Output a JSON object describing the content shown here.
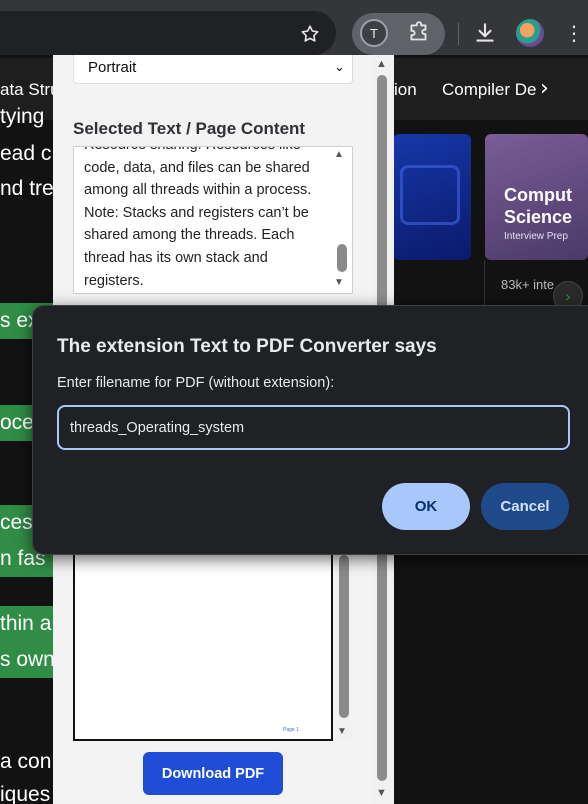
{
  "browser": {
    "star_icon": "star-icon",
    "extension_badge": "T",
    "puzzle_icon": "puzzle-icon",
    "download_icon": "download-icon",
    "menu_icon": "more-vert-icon"
  },
  "site": {
    "nav": [
      "ata Stru",
      "ion",
      "Compiler De"
    ],
    "article_lines": [
      "tying",
      "ead  c",
      "nd tre",
      "a con",
      "iques"
    ],
    "highlights": [
      "s ex",
      "oces",
      "ces",
      "n fas",
      "thin a",
      "s own"
    ],
    "card2": {
      "title": "Comput Science",
      "subtitle": "Interview Prep",
      "meta": "83k+ inte"
    }
  },
  "popup": {
    "orientation_value": "Portrait",
    "section_label": "Selected Text / Page Content",
    "content_text": "Resource sharing: Resources like code, data, and files can be shared among all threads within a process. Note: Stacks and registers can’t be shared among the threads. Each thread has its own stack and registers.",
    "preview_page_number": "Page 1",
    "download_label": "Download PDF"
  },
  "dialog": {
    "title": "The extension Text to PDF Converter says",
    "message": "Enter filename for PDF (without extension):",
    "input_value": "threads_Operating_system",
    "ok_label": "OK",
    "cancel_label": "Cancel"
  },
  "colors": {
    "accent_blue": "#1f4dd8",
    "dialog_ok": "#a8c7fa",
    "dialog_cancel": "#1e4a8a",
    "highlight_green": "#2f8d46"
  }
}
